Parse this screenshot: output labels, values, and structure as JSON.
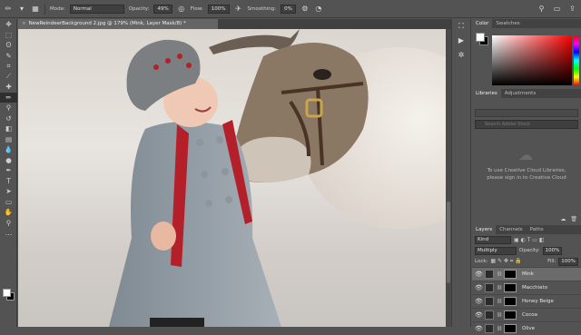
{
  "options_bar": {
    "mode_label": "Mode:",
    "mode_value": "Normal",
    "opacity_label": "Opacity:",
    "opacity_value": "49%",
    "flow_label": "Flow:",
    "flow_value": "100%",
    "smoothing_label": "Smoothing:",
    "smoothing_value": "0%"
  },
  "document": {
    "tab_title": "NewReindeerBackground 2.jpg @ 179% (Mink, Layer Mask/8) *",
    "close_glyph": "×"
  },
  "toolbar": {
    "tools": [
      {
        "name": "move-tool-icon",
        "glyph": "✥"
      },
      {
        "name": "marquee-tool-icon",
        "glyph": "⬚"
      },
      {
        "name": "lasso-tool-icon",
        "glyph": "ʘ"
      },
      {
        "name": "quick-select-tool-icon",
        "glyph": "✎"
      },
      {
        "name": "crop-tool-icon",
        "glyph": "⌗"
      },
      {
        "name": "eyedropper-tool-icon",
        "glyph": "⟋"
      },
      {
        "name": "healing-brush-icon",
        "glyph": "✚"
      },
      {
        "name": "brush-tool-icon",
        "glyph": "✏"
      },
      {
        "name": "clone-stamp-icon",
        "glyph": "⚲"
      },
      {
        "name": "history-brush-icon",
        "glyph": "↺"
      },
      {
        "name": "eraser-tool-icon",
        "glyph": "◧"
      },
      {
        "name": "gradient-tool-icon",
        "glyph": "▤"
      },
      {
        "name": "blur-tool-icon",
        "glyph": "💧"
      },
      {
        "name": "dodge-tool-icon",
        "glyph": "●"
      },
      {
        "name": "pen-tool-icon",
        "glyph": "✒"
      },
      {
        "name": "type-tool-icon",
        "glyph": "T"
      },
      {
        "name": "path-select-icon",
        "glyph": "➤"
      },
      {
        "name": "shape-tool-icon",
        "glyph": "▭"
      },
      {
        "name": "hand-tool-icon",
        "glyph": "✋"
      },
      {
        "name": "zoom-tool-icon",
        "glyph": "⚲"
      },
      {
        "name": "more-tools-icon",
        "glyph": "…"
      }
    ],
    "active_index": 7
  },
  "panels": {
    "color_tab": "Color",
    "swatches_tab": "Swatches",
    "libraries_tab": "Libraries",
    "adjustments_tab": "Adjustments",
    "search_placeholder": "Search Adobe Stock",
    "library_message": "To use Creative Cloud Libraries, please sign in to Creative Cloud",
    "layers_tab": "Layers",
    "channels_tab": "Channels",
    "paths_tab": "Paths",
    "kind_value": "Kind",
    "blend_mode": "Multiply",
    "opacity_label": "Opacity:",
    "opacity_value": "100%",
    "lock_label": "Lock:",
    "fill_label": "Fill:",
    "fill_value": "100%",
    "layers": [
      {
        "name": "Mink",
        "selected": true
      },
      {
        "name": "Macchiato",
        "selected": false
      },
      {
        "name": "Honey Beige",
        "selected": false
      },
      {
        "name": "Cocoa",
        "selected": false
      },
      {
        "name": "Olive",
        "selected": false
      }
    ]
  },
  "colors": {
    "accent": "#ff0000",
    "panel_bg": "#535353"
  }
}
